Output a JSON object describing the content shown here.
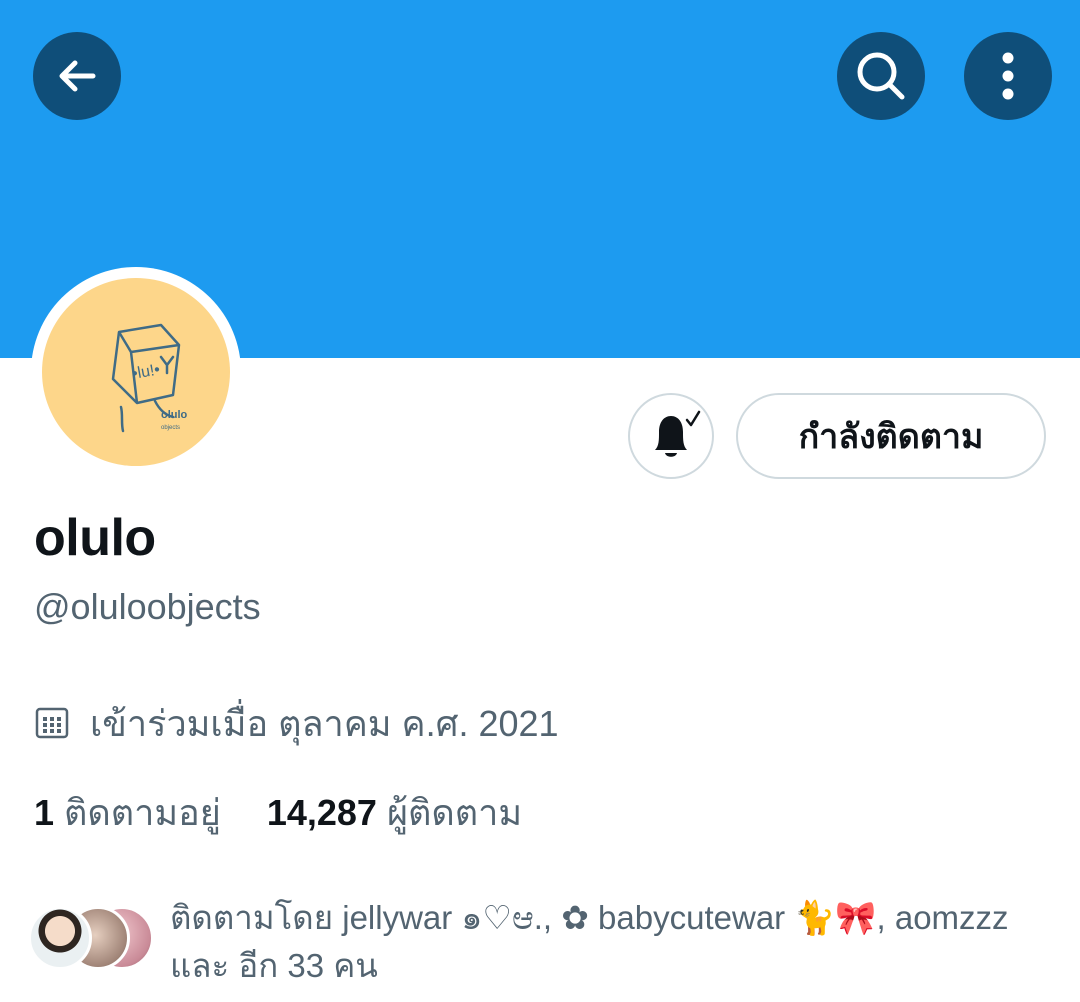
{
  "profile": {
    "display_name": "olulo",
    "handle": "@oluloobjects",
    "joined": "เข้าร่วมเมื่อ ตุลาคม ค.ศ. 2021",
    "avatar_text": "olulo"
  },
  "actions": {
    "following_label": "กำลังติดตาม"
  },
  "stats": {
    "following_count": "1",
    "following_label": "ติดตามอยู่",
    "followers_count": "14,287",
    "followers_label": "ผู้ติดตาม"
  },
  "followed_by": {
    "text": "ติดตามโดย jellywar ๑♡ಆ., ✿ babycutewar 🐈🎀, aomzzz และ อีก 33 คน"
  },
  "icons": {
    "back": "arrow-left-icon",
    "search": "search-icon",
    "more": "more-vertical-icon",
    "bell": "bell-check-icon",
    "calendar": "calendar-icon"
  },
  "colors": {
    "banner": "#1d9bf0",
    "icon_button_bg": "#0f4e79",
    "avatar_bg": "#fdd68a",
    "secondary_text": "#536471"
  }
}
